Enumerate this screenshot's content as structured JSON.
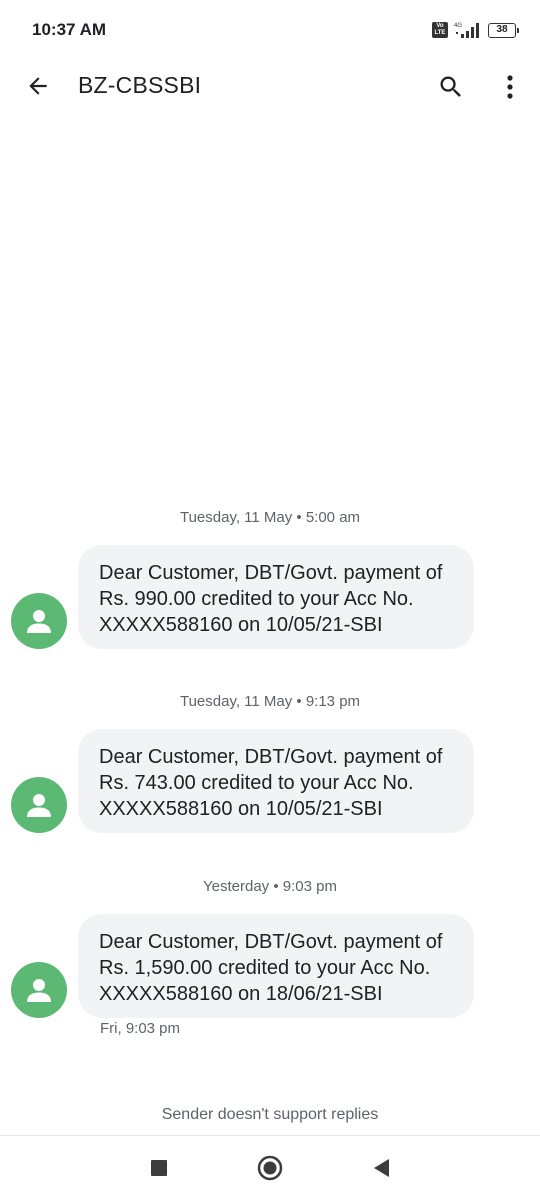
{
  "status_bar": {
    "time": "10:37 AM",
    "volte_line1": "Vo",
    "volte_line2": "LTE",
    "network": "4G",
    "battery": "38"
  },
  "app_bar": {
    "title": "BZ-CBSSBI",
    "icons": [
      "back-arrow-icon",
      "search-icon",
      "more-vert-icon"
    ]
  },
  "messages": [
    {
      "timestamp": "Tuesday, 11 May • 5:00 am",
      "text": "Dear Customer, DBT/Govt. payment of Rs. 990.00 credited to your Acc No. XXXXX588160 on 10/05/21-SBI"
    },
    {
      "timestamp": "Tuesday, 11 May • 9:13 pm",
      "text": "Dear Customer, DBT/Govt. payment of Rs. 743.00 credited to your Acc No. XXXXX588160 on 10/05/21-SBI"
    },
    {
      "timestamp": "Yesterday • 9:03 pm",
      "text": "Dear Customer, DBT/Govt. payment of Rs. 1,590.00 credited to your Acc No. XXXXX588160 on 18/06/21-SBI",
      "sent_time": "Fri, 9:03 pm"
    }
  ],
  "footer": {
    "no_reply_text": "Sender doesn't support replies"
  },
  "colors": {
    "avatar": "#5bb974",
    "bubble": "#f1f3f4",
    "secondary_text": "#5f6368"
  }
}
